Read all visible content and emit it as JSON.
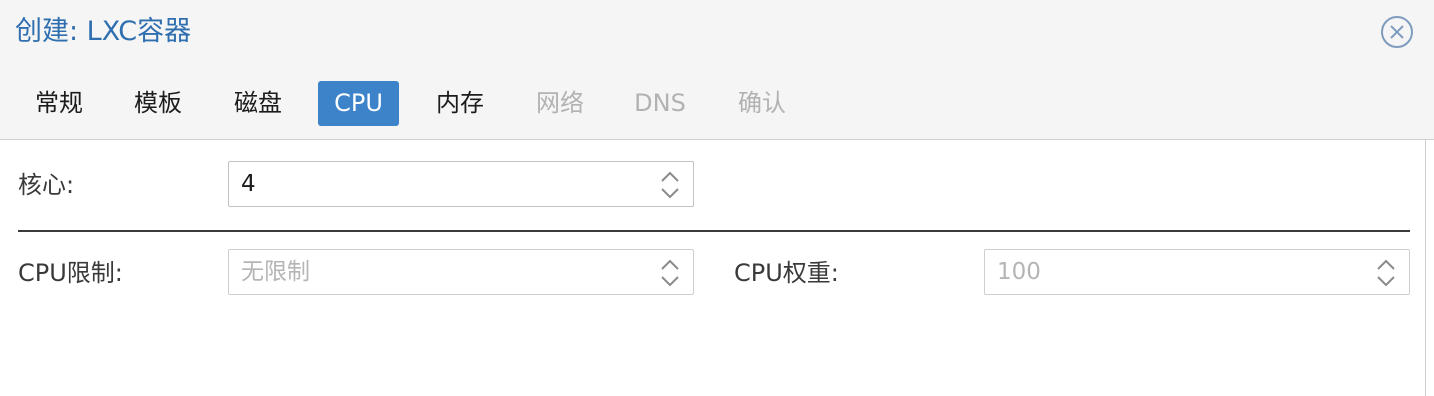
{
  "window": {
    "title": "创建: LXC容器"
  },
  "tabs": [
    {
      "label": "常规",
      "state": "normal"
    },
    {
      "label": "模板",
      "state": "normal"
    },
    {
      "label": "磁盘",
      "state": "normal"
    },
    {
      "label": "CPU",
      "state": "active"
    },
    {
      "label": "内存",
      "state": "normal"
    },
    {
      "label": "网络",
      "state": "disabled"
    },
    {
      "label": "DNS",
      "state": "disabled"
    },
    {
      "label": "确认",
      "state": "disabled"
    }
  ],
  "form": {
    "cores": {
      "label": "核心:",
      "value": "4"
    },
    "cpu_limit": {
      "label": "CPU限制:",
      "placeholder": "无限制"
    },
    "cpu_weight": {
      "label": "CPU权重:",
      "placeholder": "100"
    }
  },
  "colors": {
    "accent": "#3c83c9",
    "title": "#2f6fb0",
    "disabled_text": "#b2b2b2"
  },
  "icons": {
    "close": "close-circle-icon",
    "spinner": "chevron-up-down-icon"
  }
}
